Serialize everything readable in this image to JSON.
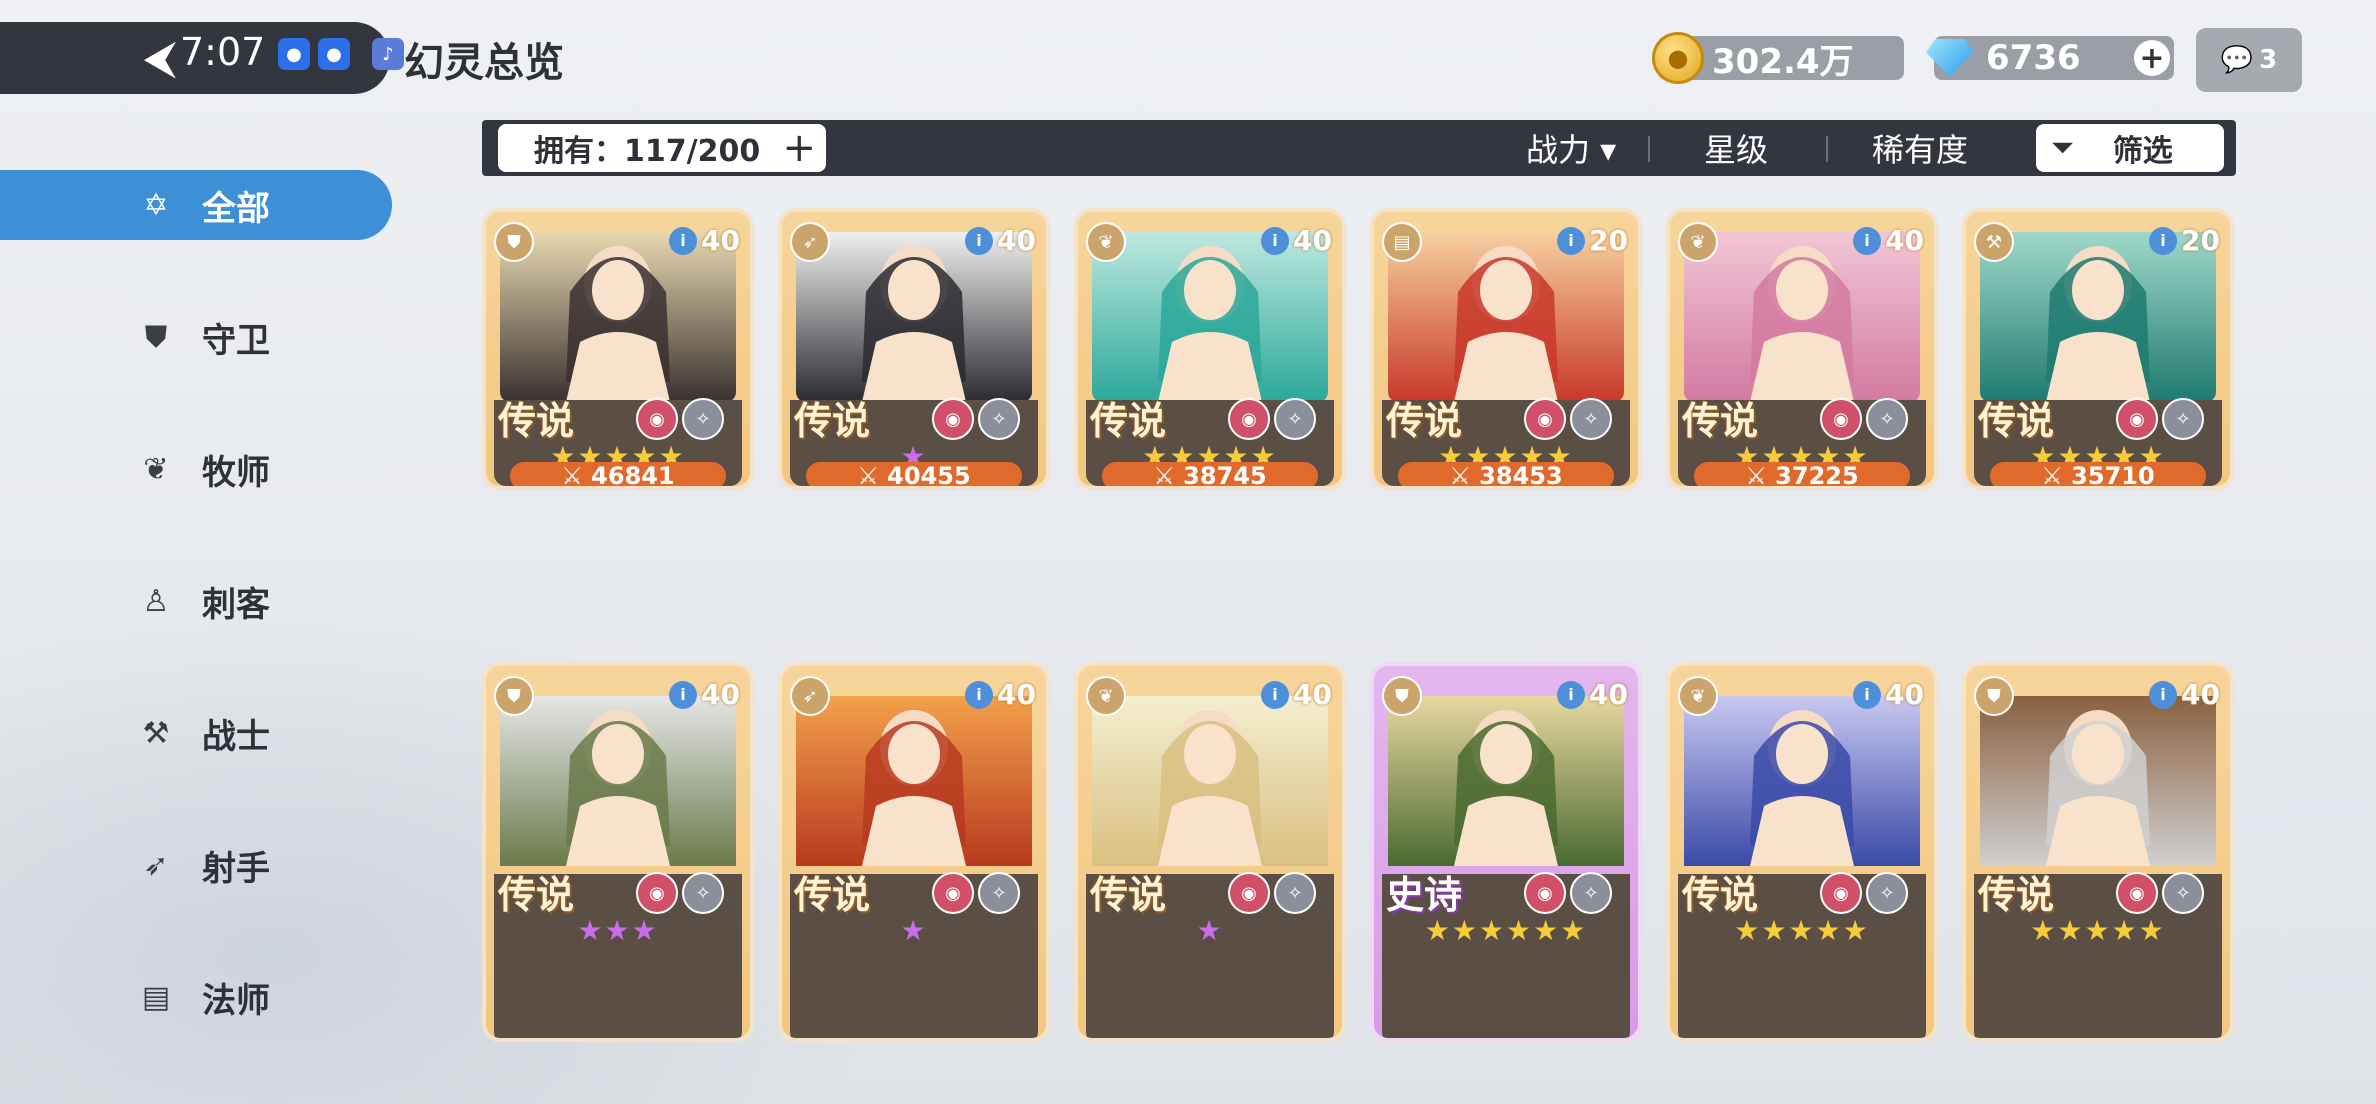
{
  "status": {
    "time": "7:07"
  },
  "header": {
    "title": "幻灵总览",
    "back_icon": "back-arrow-icon"
  },
  "currency": {
    "gold": "302.4万",
    "gems": "6736",
    "chat_badge": "3"
  },
  "filter_bar": {
    "owned_label": "拥有：117/200",
    "sort_options": [
      "战力 ▾",
      "星级",
      "稀有度"
    ],
    "filter_label": "筛选"
  },
  "sidebar": {
    "items": [
      {
        "label": "全部",
        "icon": "all-star-icon",
        "active": true
      },
      {
        "label": "守卫",
        "icon": "shield-icon",
        "active": false
      },
      {
        "label": "牧师",
        "icon": "wing-icon",
        "active": false
      },
      {
        "label": "刺客",
        "icon": "hood-icon",
        "active": false
      },
      {
        "label": "战士",
        "icon": "hammer-icon",
        "active": false
      },
      {
        "label": "射手",
        "icon": "bow-icon",
        "active": false
      },
      {
        "label": "法师",
        "icon": "book-icon",
        "active": false
      }
    ]
  },
  "cards": [
    {
      "rarity": "传说",
      "level": "40",
      "stars": 5,
      "star_color": "gold",
      "power": "46841",
      "class": "shield-icon"
    },
    {
      "rarity": "传说",
      "level": "40",
      "stars": 1,
      "star_color": "purple",
      "power": "40455",
      "class": "bow-icon"
    },
    {
      "rarity": "传说",
      "level": "40",
      "stars": 5,
      "star_color": "gold",
      "power": "38745",
      "class": "wing-icon"
    },
    {
      "rarity": "传说",
      "level": "20",
      "stars": 5,
      "star_color": "gold",
      "power": "38453",
      "class": "book-icon"
    },
    {
      "rarity": "传说",
      "level": "40",
      "stars": 5,
      "star_color": "gold",
      "power": "37225",
      "class": "wing-icon"
    },
    {
      "rarity": "传说",
      "level": "20",
      "stars": 5,
      "star_color": "gold",
      "power": "35710",
      "class": "hammer-icon"
    },
    {
      "rarity": "传说",
      "level": "40",
      "stars": 3,
      "star_color": "purple",
      "class": "shield-icon"
    },
    {
      "rarity": "传说",
      "level": "40",
      "stars": 1,
      "star_color": "purple",
      "class": "bow-icon"
    },
    {
      "rarity": "传说",
      "level": "40",
      "stars": 1,
      "star_color": "purple",
      "class": "wing-icon"
    },
    {
      "rarity": "史诗",
      "level": "40",
      "stars": 6,
      "star_color": "gold",
      "class": "shield-icon"
    },
    {
      "rarity": "传说",
      "level": "40",
      "stars": 5,
      "star_color": "gold",
      "class": "wing-icon"
    },
    {
      "rarity": "传说",
      "level": "40",
      "stars": 5,
      "star_color": "gold",
      "class": "shield-icon"
    }
  ]
}
